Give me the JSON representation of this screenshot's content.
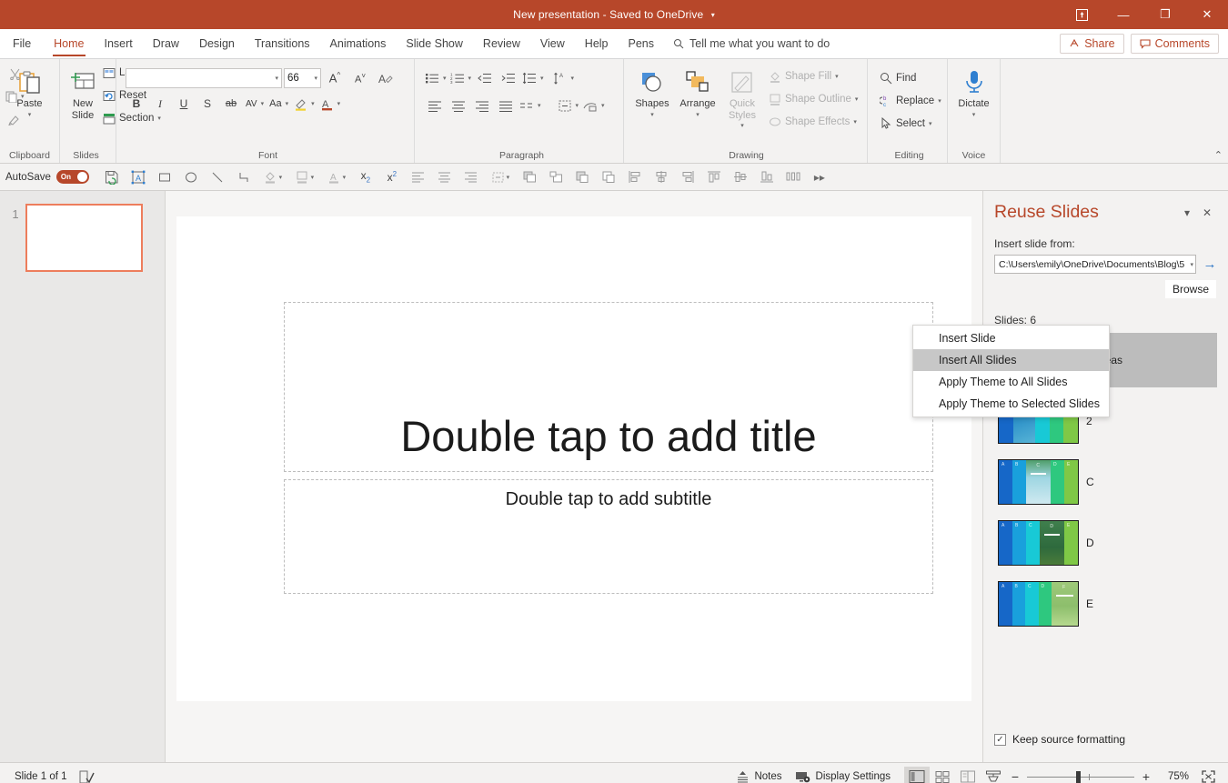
{
  "titlebar": {
    "title": "New presentation",
    "separator": "-",
    "saved_status": "Saved to OneDrive",
    "dropdown_caret": "▾",
    "restore_label": "⛶",
    "minimize_label": "—",
    "maximize_label": "❐",
    "close_label": "✕"
  },
  "tabs": [
    {
      "label": "File"
    },
    {
      "label": "Home"
    },
    {
      "label": "Insert"
    },
    {
      "label": "Draw"
    },
    {
      "label": "Design"
    },
    {
      "label": "Transitions"
    },
    {
      "label": "Animations"
    },
    {
      "label": "Slide Show"
    },
    {
      "label": "Review"
    },
    {
      "label": "View"
    },
    {
      "label": "Help"
    },
    {
      "label": "Pens"
    }
  ],
  "active_tab": "Home",
  "tellme": {
    "placeholder": "Tell me what you want to do"
  },
  "header_actions": {
    "share": "Share",
    "comments": "Comments"
  },
  "ribbon": {
    "groups": [
      {
        "name": "Clipboard",
        "label": "Clipboard"
      },
      {
        "name": "Slides",
        "label": "Slides"
      },
      {
        "name": "Font",
        "label": "Font"
      },
      {
        "name": "Paragraph",
        "label": "Paragraph"
      },
      {
        "name": "Drawing",
        "label": "Drawing"
      },
      {
        "name": "Editing",
        "label": "Editing"
      },
      {
        "name": "Voice",
        "label": "Voice"
      }
    ],
    "clipboard": {
      "paste": "Paste"
    },
    "slides": {
      "new_slide": "New Slide",
      "layout": "Layout",
      "reset": "Reset",
      "section": "Section"
    },
    "font": {
      "font_name_value": "",
      "font_size_value": "66",
      "bold": "B",
      "italic": "I",
      "underline": "U",
      "shadow": "S",
      "strikethrough": "ab",
      "char_spacing": "AV",
      "change_case": "Aa"
    },
    "drawing": {
      "shapes": "Shapes",
      "arrange": "Arrange",
      "quick_styles": "Quick Styles",
      "shape_fill": "Shape Fill",
      "shape_outline": "Shape Outline",
      "shape_effects": "Shape Effects"
    },
    "editing": {
      "find": "Find",
      "replace": "Replace",
      "select": "Select"
    },
    "voice": {
      "dictate": "Dictate"
    },
    "collapse_caret": "⌃"
  },
  "toolbar2": {
    "autosave_label": "AutoSave",
    "autosave_state": "On",
    "overflow": "▸▸"
  },
  "thumbnail_pane": {
    "slides": [
      {
        "number": "1"
      }
    ]
  },
  "slide": {
    "title_placeholder": "Double tap to add title",
    "subtitle_placeholder": "Double tap to add subtitle"
  },
  "reuse_pane": {
    "title": "Reuse Slides",
    "minimize_caret": "▾",
    "close": "✕",
    "insert_from_label": "Insert slide from:",
    "path_value": "C:\\Users\\emily\\OneDrive\\Documents\\Blog\\5",
    "path_caret": "▾",
    "go_arrow": "→",
    "browse_label": "Browse",
    "slides_count_label": "Slides: 6",
    "keep_source_formatting": "Keep source formatting",
    "keep_source_checked": true,
    "slide_items": [
      {
        "label": "s Areas",
        "selected": true,
        "photo": "#1f8fc0",
        "active_band": 0
      },
      {
        "label": "2",
        "selected": false,
        "photo": "#2a7fb5",
        "active_band": 1
      },
      {
        "label": "C",
        "selected": false,
        "photo": "#8fd4e0",
        "active_band": 2
      },
      {
        "label": "D",
        "selected": false,
        "photo": "#3a7a4a",
        "active_band": 3
      },
      {
        "label": "E",
        "selected": false,
        "photo": "#9ec97a",
        "active_band": 4
      }
    ],
    "band_colors": [
      "#1667c8",
      "#19a0dc",
      "#18c9d6",
      "#2ec87f",
      "#7fc846"
    ]
  },
  "context_menu": {
    "items": [
      {
        "label": "Insert Slide",
        "highlighted": false
      },
      {
        "label": "Insert All Slides",
        "highlighted": true
      },
      {
        "label": "Apply Theme to All Slides",
        "highlighted": false
      },
      {
        "label": "Apply Theme to Selected Slides",
        "highlighted": false
      }
    ]
  },
  "statusbar": {
    "slide_indicator": "Slide 1 of 1",
    "notes": "Notes",
    "display_settings": "Display Settings",
    "zoom_out": "−",
    "zoom_in": "+",
    "zoom_value": "75%"
  },
  "colors": {
    "accent": "#b7472a",
    "ribbon_bg": "#f3f2f1",
    "selection_gray": "#bcbcbc",
    "thumb_border": "#ed7d5c"
  }
}
